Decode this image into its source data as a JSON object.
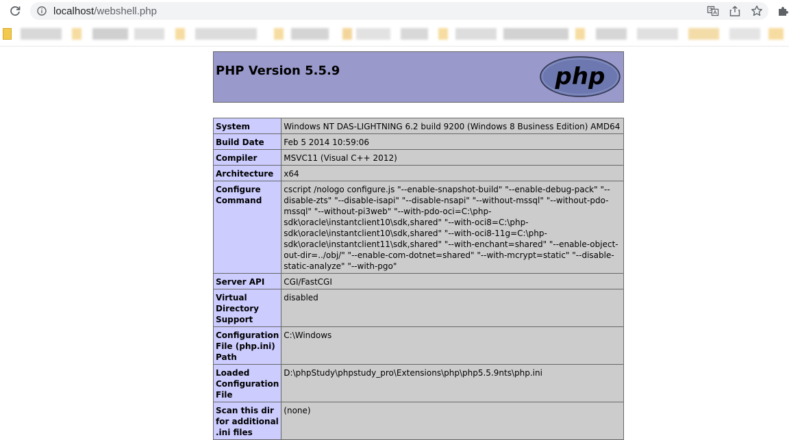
{
  "browser": {
    "url_host": "localhost",
    "url_path": "/webshell.php"
  },
  "page": {
    "title": "PHP Version 5.5.9",
    "logo_text": "php"
  },
  "rows": [
    {
      "label": "System",
      "value": "Windows NT DAS-LIGHTNING 6.2 build 9200 (Windows 8 Business Edition) AMD64"
    },
    {
      "label": "Build Date",
      "value": "Feb 5 2014 10:59:06"
    },
    {
      "label": "Compiler",
      "value": "MSVC11 (Visual C++ 2012)"
    },
    {
      "label": "Architecture",
      "value": "x64"
    },
    {
      "label": "Configure Command",
      "value": "cscript /nologo configure.js \"--enable-snapshot-build\" \"--enable-debug-pack\" \"--disable-zts\" \"--disable-isapi\" \"--disable-nsapi\" \"--without-mssql\" \"--without-pdo-mssql\" \"--without-pi3web\" \"--with-pdo-oci=C:\\php-sdk\\oracle\\instantclient10\\sdk,shared\" \"--with-oci8=C:\\php-sdk\\oracle\\instantclient10\\sdk,shared\" \"--with-oci8-11g=C:\\php-sdk\\oracle\\instantclient11\\sdk,shared\" \"--with-enchant=shared\" \"--enable-object-out-dir=../obj/\" \"--enable-com-dotnet=shared\" \"--with-mcrypt=static\" \"--disable-static-analyze\" \"--with-pgo\""
    },
    {
      "label": "Server API",
      "value": "CGI/FastCGI"
    },
    {
      "label": "Virtual Directory Support",
      "value": "disabled"
    },
    {
      "label": "Configuration File (php.ini) Path",
      "value": "C:\\Windows"
    },
    {
      "label": "Loaded Configuration File",
      "value": "D:\\phpStudy\\phpstudy_pro\\Extensions\\php\\php5.5.9nts\\php.ini"
    },
    {
      "label": "Scan this dir for additional .ini files",
      "value": "(none)"
    }
  ],
  "colors": {
    "header_bg": "#9999cc",
    "label_bg": "#ccccff",
    "value_bg": "#cccccc"
  }
}
